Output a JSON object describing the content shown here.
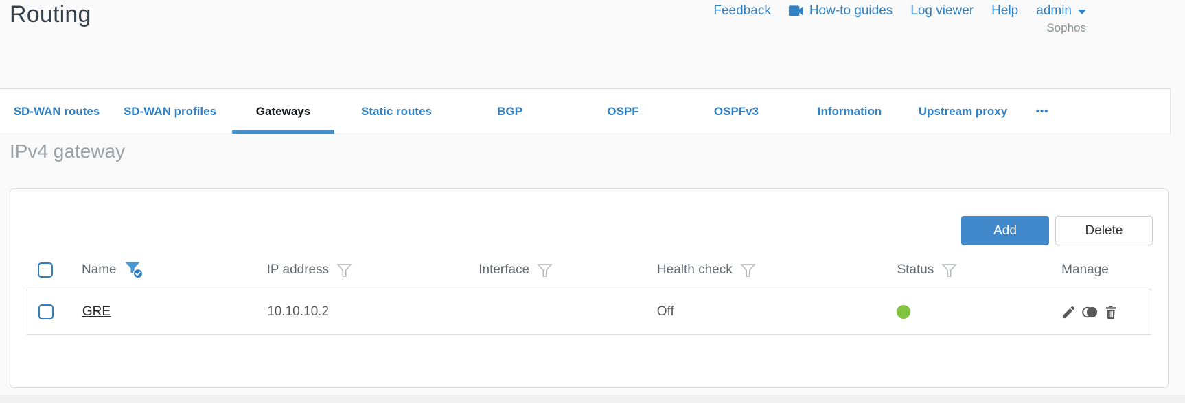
{
  "page": {
    "title": "Routing",
    "brand": "Sophos"
  },
  "top_nav": {
    "feedback": "Feedback",
    "howto_guides": "How-to guides",
    "howto_icon": "videocam-icon",
    "log_viewer": "Log viewer",
    "help": "Help",
    "user": "admin",
    "user_icon": "caret-down-icon"
  },
  "tabs": {
    "items": [
      {
        "label": "SD-WAN routes",
        "active": false
      },
      {
        "label": "SD-WAN profiles",
        "active": false
      },
      {
        "label": "Gateways",
        "active": true
      },
      {
        "label": "Static routes",
        "active": false
      },
      {
        "label": "BGP",
        "active": false
      },
      {
        "label": "OSPF",
        "active": false
      },
      {
        "label": "OSPFv3",
        "active": false
      },
      {
        "label": "Information",
        "active": false
      },
      {
        "label": "Upstream proxy",
        "active": false
      }
    ],
    "more": "•••"
  },
  "section": {
    "title": "IPv4 gateway"
  },
  "toolbar": {
    "add_label": "Add",
    "delete_label": "Delete"
  },
  "table": {
    "columns": [
      {
        "label": "Name",
        "filter_icon": "funnel-icon",
        "filter_state": "active"
      },
      {
        "label": "IP address",
        "filter_icon": "funnel-icon",
        "filter_state": "inactive"
      },
      {
        "label": "Interface",
        "filter_icon": "funnel-icon",
        "filter_state": "inactive"
      },
      {
        "label": "Health check",
        "filter_icon": "funnel-icon",
        "filter_state": "inactive"
      },
      {
        "label": "Status",
        "filter_icon": "funnel-icon",
        "filter_state": "inactive"
      },
      {
        "label": "Manage",
        "filter_icon": "none",
        "filter_state": "none"
      }
    ],
    "rows": [
      {
        "name": "GRE",
        "ip_address": "10.10.10.2",
        "interface": "",
        "health_check": "Off",
        "status": "up",
        "status_color": "#83c342",
        "manage_icons": [
          "edit-icon",
          "clone-icon",
          "trash-icon"
        ]
      }
    ]
  },
  "colors": {
    "accent_blue": "#3181c4",
    "button_blue": "#4189ca",
    "status_green": "#83c342",
    "active_filter_blue": "#4a97d2"
  }
}
